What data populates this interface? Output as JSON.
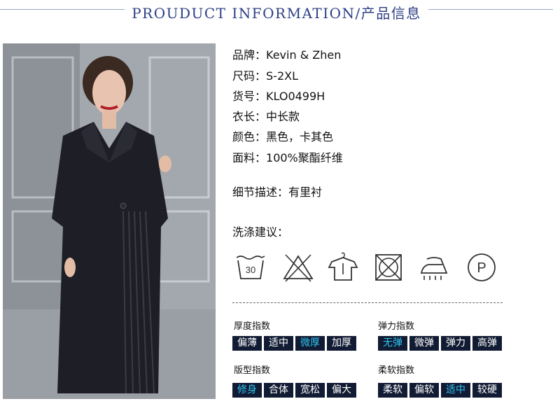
{
  "header": {
    "title": "PROUDUCT INFORMATION/产品信息"
  },
  "photo": {
    "alt": "model wearing long black blazer dress with pleated panel"
  },
  "info": [
    {
      "label": "品牌：",
      "value": "Kevin & Zhen"
    },
    {
      "label": "尺码：",
      "value": "S-2XL"
    },
    {
      "label": "货号：",
      "value": "KLO0499H"
    },
    {
      "label": "衣长：",
      "value": "中长款"
    },
    {
      "label": "颜色：",
      "value": "黑色，卡其色"
    },
    {
      "label": "面料：",
      "value": "100%聚酯纤维"
    }
  ],
  "detail": {
    "label": "细节描述：",
    "value": "有里衬"
  },
  "care": {
    "label": "洗涤建议：",
    "icons": [
      {
        "name": "wash-30-icon",
        "text": "30"
      },
      {
        "name": "no-bleach-icon",
        "text": ""
      },
      {
        "name": "hang-dry-icon",
        "text": ""
      },
      {
        "name": "no-tumble-dry-icon",
        "text": ""
      },
      {
        "name": "steam-iron-icon",
        "text": ""
      },
      {
        "name": "dry-clean-p-icon",
        "text": "P"
      }
    ]
  },
  "indices": {
    "thickness": {
      "title": "厚度指数",
      "options": [
        "偏薄",
        "适中",
        "微厚",
        "加厚"
      ],
      "active": 2
    },
    "elasticity": {
      "title": "弹力指数",
      "options": [
        "无弹",
        "微弹",
        "弹力",
        "高弹"
      ],
      "active": 0
    },
    "fit": {
      "title": "版型指数",
      "options": [
        "修身",
        "合体",
        "宽松",
        "偏大"
      ],
      "active": 0
    },
    "softness": {
      "title": "柔软指数",
      "options": [
        "柔软",
        "偏软",
        "适中",
        "较硬"
      ],
      "active": 2
    }
  },
  "colors": {
    "accent": "#2fc4f0",
    "chip_bg": "#111b33",
    "header": "#2d3f86"
  }
}
